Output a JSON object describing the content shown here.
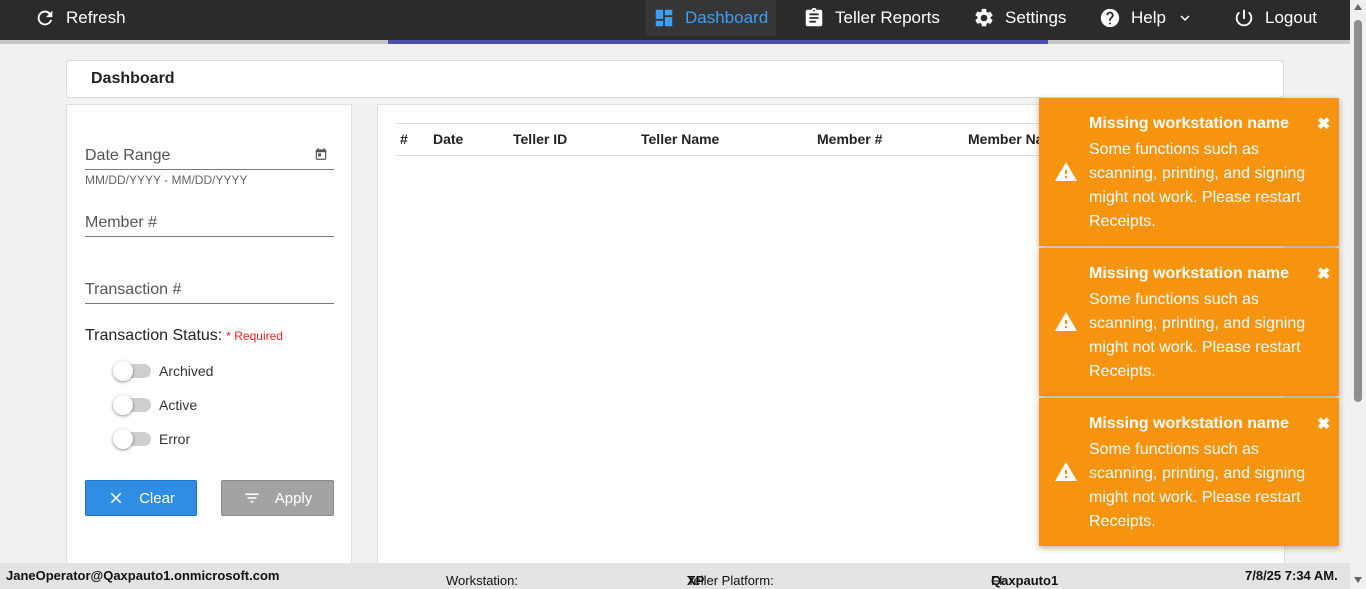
{
  "topbar": {
    "refresh_label": "Refresh",
    "dashboard_label": "Dashboard",
    "reports_label": "Teller Reports",
    "settings_label": "Settings",
    "help_label": "Help",
    "logout_label": "Logout"
  },
  "page": {
    "title": "Dashboard"
  },
  "filters": {
    "date_range_label": "Date Range",
    "date_range_hint": "MM/DD/YYYY - MM/DD/YYYY",
    "member_label": "Member #",
    "transaction_label": "Transaction #",
    "status_label": "Transaction Status:",
    "required_label": "* Required",
    "toggles": [
      {
        "label": "Archived"
      },
      {
        "label": "Active"
      },
      {
        "label": "Error"
      }
    ],
    "clear_label": "Clear",
    "apply_label": "Apply"
  },
  "table": {
    "columns": [
      "#",
      "Date",
      "Teller ID",
      "Teller Name",
      "Member #",
      "Member Na"
    ]
  },
  "toasts": [
    {
      "title": "Missing workstation name",
      "message": "Some functions such as scanning, printing, and signing might not work. Please restart Receipts.",
      "close": "✖"
    },
    {
      "title": "Missing workstation name",
      "message": "Some functions such as scanning, printing, and signing might not work. Please restart Receipts.",
      "close": "✖"
    },
    {
      "title": "Missing workstation name",
      "message": "Some functions such as scanning, printing, and signing might not work. Please restart Receipts.",
      "close": "✖"
    }
  ],
  "footer": {
    "user": "JaneOperator@Qaxpauto1.onmicrosoft.com",
    "workstation_label": "Workstation:",
    "workstation_value": "",
    "platform_label": "Teller Platform:",
    "platform_value": "XP",
    "fi_label": "FI:",
    "fi_value": "Qaxpauto1",
    "datetime": "7/8/25 7:34 AM."
  },
  "colors": {
    "topbar_bg": "#2b2b2b",
    "active_nav": "#3aa0ff",
    "toast_bg": "#f7940f",
    "clear_button": "#2f8de4",
    "apply_button": "#a3a3a3",
    "required": "#ee2222"
  }
}
